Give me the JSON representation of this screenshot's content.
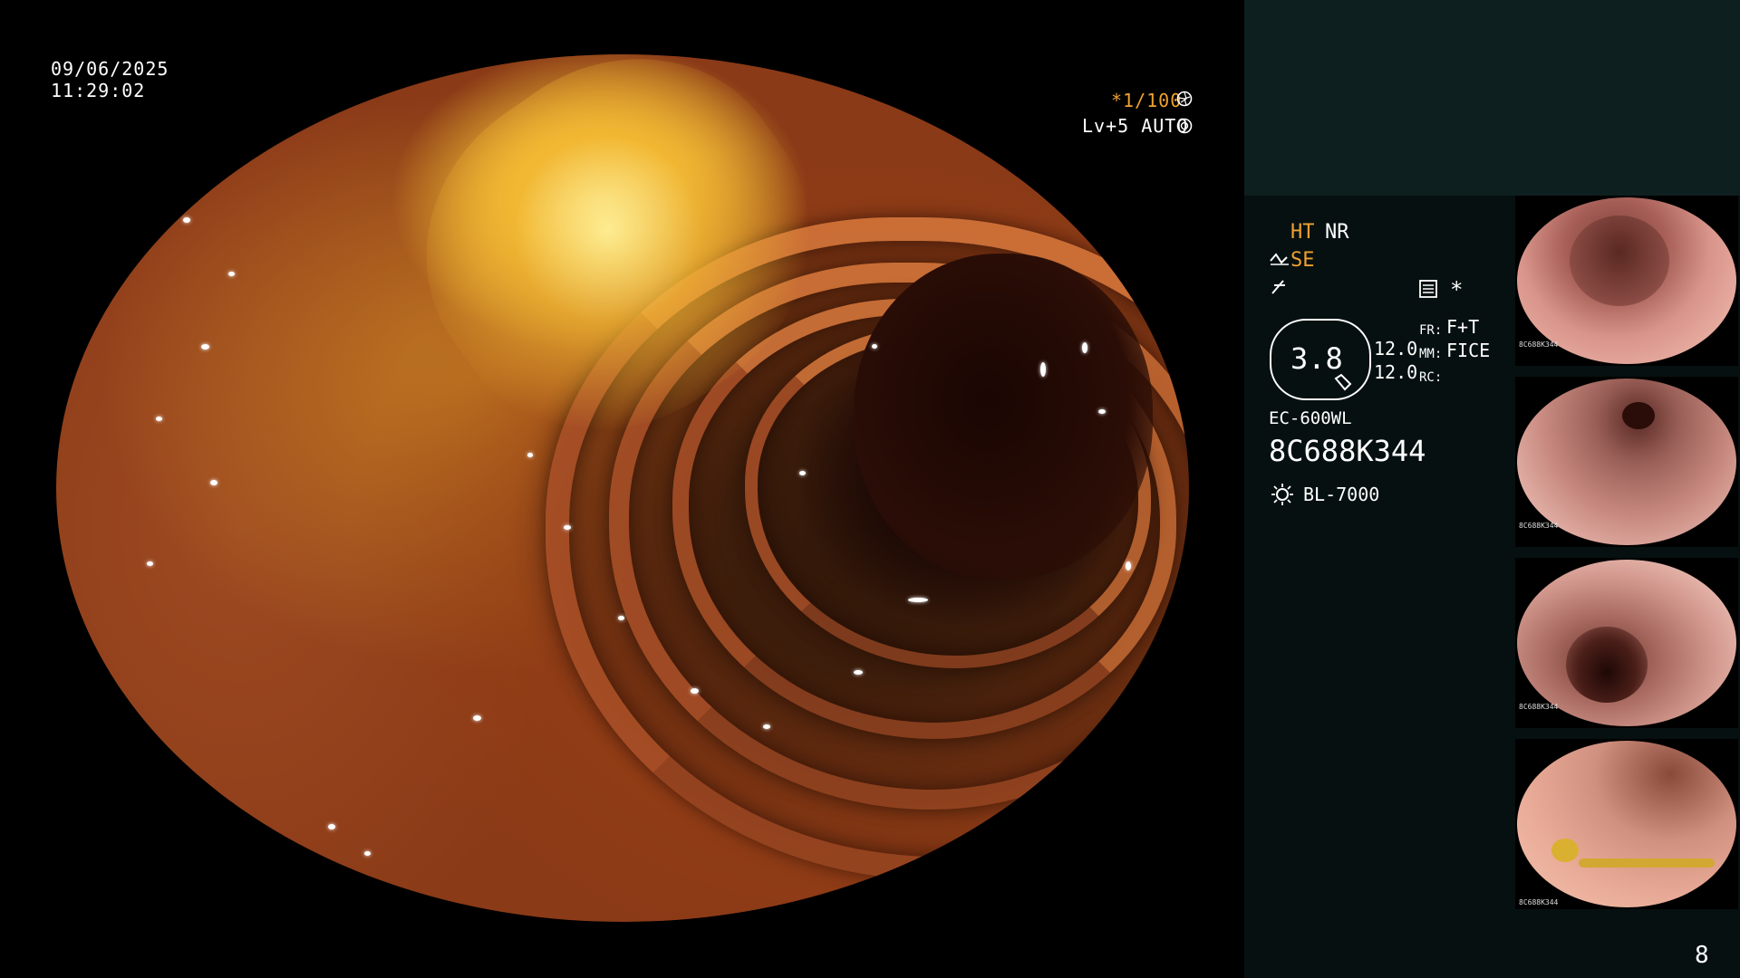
{
  "overlay": {
    "date": "09/06/2025",
    "time": "11:29:02",
    "shutter": "*1/100",
    "shutter_icon": "aperture-icon",
    "brightness": "Lv+5 AUTO",
    "brightness_icon": "iris-icon"
  },
  "panel": {
    "ht": "HT",
    "nr": "NR",
    "se": "SE",
    "zoom_value": "3.8",
    "val_top": "12.0",
    "val_bottom": "12.0",
    "fr_label": "FR:",
    "fr_value": "F+T",
    "mm_label": "MM:",
    "mm_value": "FICE",
    "rc_label": "RC:",
    "scope_model": "EC-600WL",
    "serial": "8C688K344",
    "light_source": "BL-7000",
    "page_number": "8"
  },
  "colors": {
    "accent_orange": "#f0a030",
    "panel_bg": "#061010",
    "panel_top_bg": "#0e1f1f"
  },
  "thumbnails": [
    {
      "label": "thumbnail-1"
    },
    {
      "label": "thumbnail-2"
    },
    {
      "label": "thumbnail-3"
    },
    {
      "label": "thumbnail-4"
    }
  ]
}
